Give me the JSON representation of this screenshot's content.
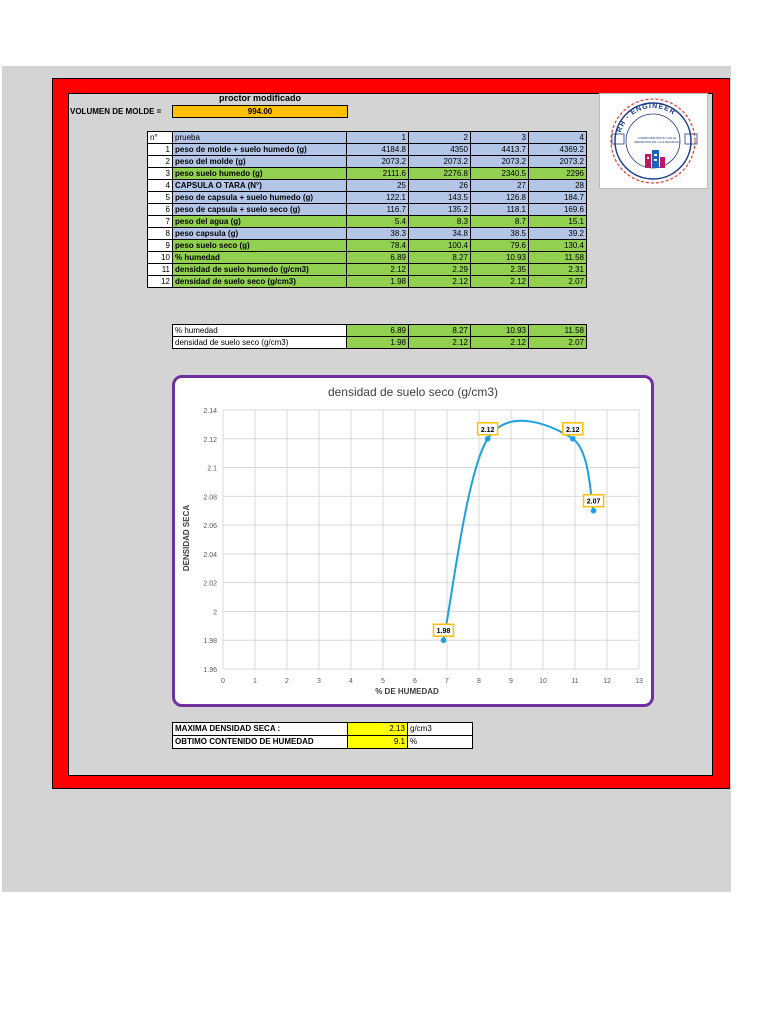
{
  "header": {
    "title": "proctor modificado",
    "volume_label": "VOLUMEN DE MOLDE =",
    "volume_value": "994.00"
  },
  "logo": {
    "ring_text": "RH - ENGINEER",
    "tagline_1": "COMPROMETIDOS CON EL",
    "tagline_2": "BIENESTAR DE LA HUMANIDAD"
  },
  "table": {
    "header": [
      "n°",
      "prueba",
      "1",
      "2",
      "3",
      "4"
    ],
    "rows": [
      {
        "n": "1",
        "label": "peso de molde + suelo humedo (g)",
        "values": [
          "4184.8",
          "4350",
          "4413.7",
          "4369.2"
        ],
        "color": "blue"
      },
      {
        "n": "2",
        "label": "peso del molde (g)",
        "values": [
          "2073.2",
          "2073.2",
          "2073.2",
          "2073.2"
        ],
        "color": "blue"
      },
      {
        "n": "3",
        "label": "peso suelo humedo (g)",
        "values": [
          "2111.6",
          "2276.8",
          "2340.5",
          "2296"
        ],
        "color": "green"
      },
      {
        "n": "4",
        "label": "CAPSULA O TARA (N°)",
        "values": [
          "25",
          "26",
          "27",
          "28"
        ],
        "color": "blue"
      },
      {
        "n": "5",
        "label": "peso de capsula + suelo humedo (g)",
        "values": [
          "122.1",
          "143.5",
          "126.8",
          "184.7"
        ],
        "color": "blue"
      },
      {
        "n": "6",
        "label": "peso de capsula + suelo seco (g)",
        "values": [
          "116.7",
          "135.2",
          "118.1",
          "169.6"
        ],
        "color": "blue"
      },
      {
        "n": "7",
        "label": "peso del agua (g)",
        "values": [
          "5.4",
          "8.3",
          "8.7",
          "15.1"
        ],
        "color": "green"
      },
      {
        "n": "8",
        "label": "peso capsula (g)",
        "values": [
          "38.3",
          "34.8",
          "38.5",
          "39.2"
        ],
        "color": "blue"
      },
      {
        "n": "9",
        "label": "peso suelo seco (g)",
        "values": [
          "78.4",
          "100.4",
          "79.6",
          "130.4"
        ],
        "color": "green"
      },
      {
        "n": "10",
        "label": "% humedad",
        "values": [
          "6.89",
          "8.27",
          "10.93",
          "11.58"
        ],
        "color": "green"
      },
      {
        "n": "11",
        "label": "densidad de suelo humedo (g/cm3)",
        "values": [
          "2.12",
          "2.29",
          "2.35",
          "2.31"
        ],
        "color": "green"
      },
      {
        "n": "12",
        "label": "densidad de suelo seco (g/cm3)",
        "values": [
          "1.98",
          "2.12",
          "2.12",
          "2.07"
        ],
        "color": "green"
      }
    ]
  },
  "summary_table": {
    "rows": [
      {
        "label": "% humedad",
        "values": [
          "6.89",
          "8.27",
          "10.93",
          "11.58"
        ]
      },
      {
        "label": "densidad de suelo seco (g/cm3)",
        "values": [
          "1.98",
          "2.12",
          "2.12",
          "2.07"
        ]
      }
    ]
  },
  "results": {
    "max_density_label": "MAXIMA DENSIDAD SECA :",
    "max_density_value": "2.13",
    "max_density_unit": "g/cm3",
    "optimum_label": "OBTIMO CONTENIDO DE HUMEDAD",
    "optimum_value": "9.1",
    "optimum_unit": "%"
  },
  "colors": {
    "frame": "#ff0000",
    "chart_border": "#7030a0",
    "curve": "#1ba1e2",
    "label_box": "#ffc000",
    "blue_cell": "#b4c6e7",
    "green_cell": "#92d050",
    "yellow_cell": "#ffff00"
  },
  "chart_data": {
    "type": "scatter",
    "title": "densidad de suelo seco (g/cm3)",
    "xlabel": "% DE HUMEDAD",
    "ylabel": "DENSIDAD SECA",
    "xlim": [
      0,
      13
    ],
    "ylim": [
      1.96,
      2.14
    ],
    "xticks": [
      "0",
      "1",
      "2",
      "3",
      "4",
      "5",
      "6",
      "7",
      "8",
      "9",
      "10",
      "11",
      "12",
      "13"
    ],
    "yticks": [
      "1.96",
      "1.98",
      "2",
      "2.02",
      "2.04",
      "2.06",
      "2.08",
      "2.1",
      "2.12",
      "2.14"
    ],
    "grid": true,
    "smooth_line": true,
    "series": [
      {
        "x": [
          6.89,
          8.27,
          10.93,
          11.58
        ],
        "y": [
          1.98,
          2.12,
          2.12,
          2.07
        ],
        "labels": [
          "1.98",
          "2.12",
          "2.12",
          "2.07"
        ]
      }
    ]
  }
}
